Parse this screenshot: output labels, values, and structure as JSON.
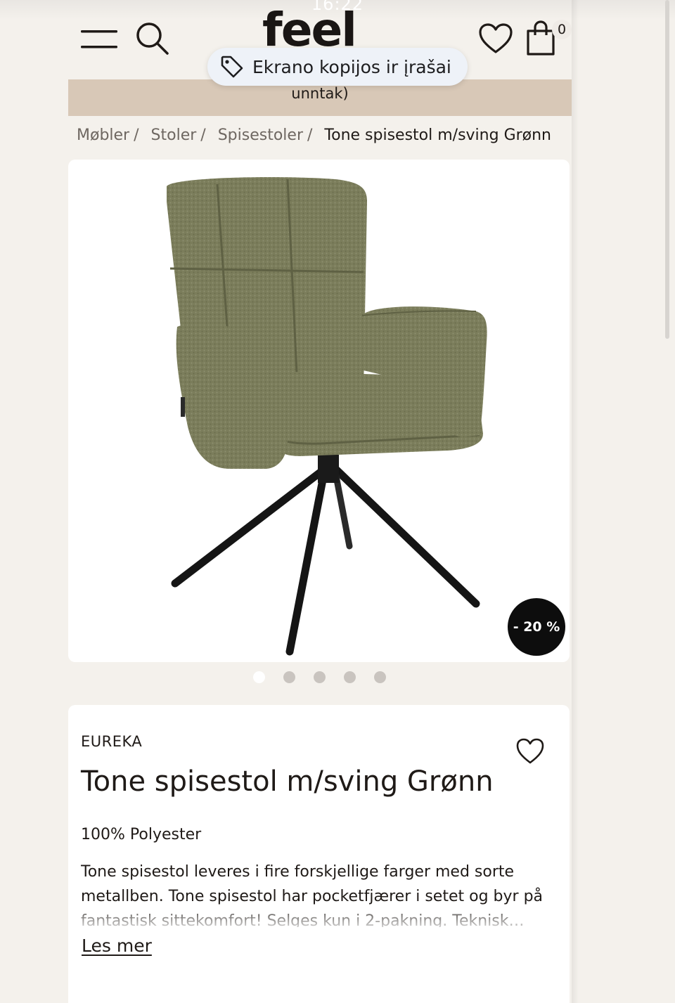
{
  "status_bar": {
    "time": "16:22"
  },
  "header": {
    "logo": "feel",
    "cart_count": "0",
    "icons": [
      "hamburger-menu-icon",
      "search-icon",
      "heart-icon",
      "shopping-bag-icon"
    ]
  },
  "toast": {
    "icon": "tag-icon",
    "text": "Ekrano kopijos ir įrašai"
  },
  "banner": {
    "text": "unntak)"
  },
  "breadcrumb": {
    "items": [
      "Møbler",
      "Stoler",
      "Spisestoler"
    ],
    "separator": "/",
    "current": "Tone spisestol m/sving Grønn"
  },
  "gallery": {
    "discount_badge": "- 20 %",
    "slide_count": 5,
    "active_slide": 1
  },
  "product": {
    "brand": "EUREKA",
    "title": "Tone spisestol m/sving Grønn",
    "material": "100% Polyester",
    "description": "Tone spisestol leveres i fire forskjellige farger med sorte metallben. Tone spisestol har pocketfjærer i setet og byr på fantastisk sittekomfort! Selges kun i 2-pakning. Teknisk…",
    "read_more": "Les mer"
  },
  "colors": {
    "page_bg": "#f4f1ec",
    "banner_bg": "#d8c8b7",
    "chair_fabric": "#7d7f5c",
    "badge_bg": "#0d0d0d",
    "text": "#1f1a17"
  }
}
